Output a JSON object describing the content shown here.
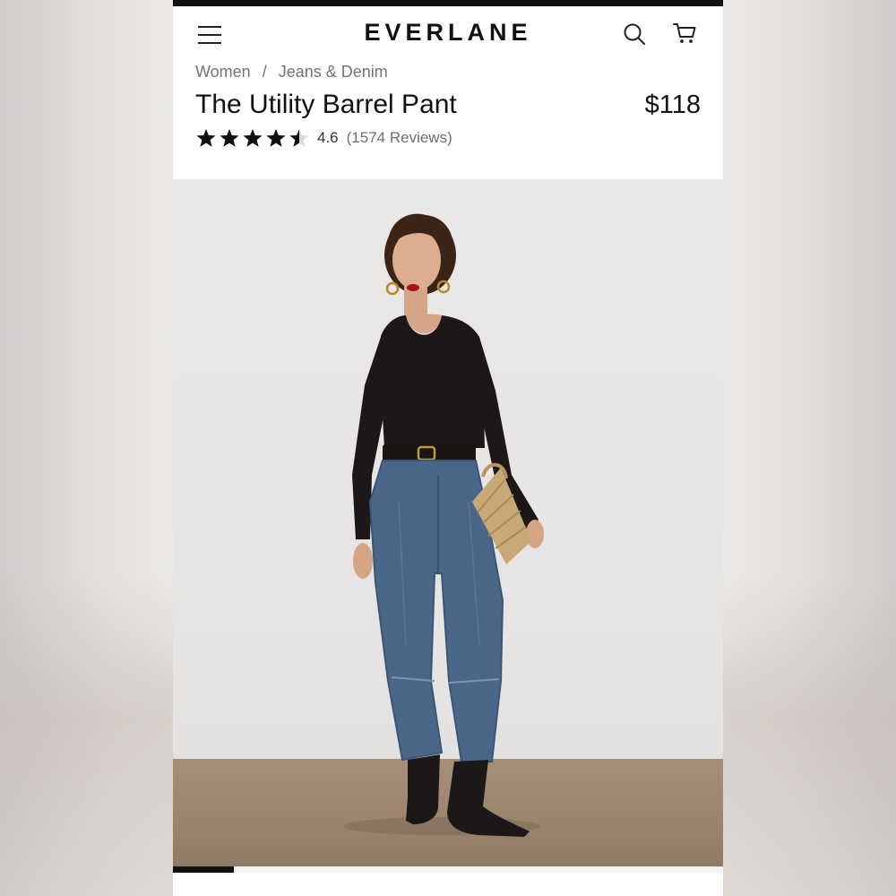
{
  "header": {
    "logo": "EVERLANE",
    "menu_icon": "hamburger-menu-icon",
    "search_icon": "search-icon",
    "cart_icon": "shopping-cart-icon"
  },
  "breadcrumb": {
    "items": [
      {
        "label": "Women"
      },
      {
        "label": "Jeans & Denim"
      }
    ],
    "separator": "/"
  },
  "product": {
    "title": "The Utility Barrel Pant",
    "price": "$118",
    "rating": {
      "value": "4.6",
      "stars_filled": 4.5,
      "stars_total": 5,
      "reviews_label": "(1574 Reviews)"
    }
  },
  "gallery": {
    "image": "product-photo-model-barrel-jeans",
    "progress_fraction": 0.11
  },
  "colors": {
    "text_primary": "#111111",
    "text_secondary": "#737373",
    "background": "#ffffff",
    "accent_bar": "#111111"
  }
}
